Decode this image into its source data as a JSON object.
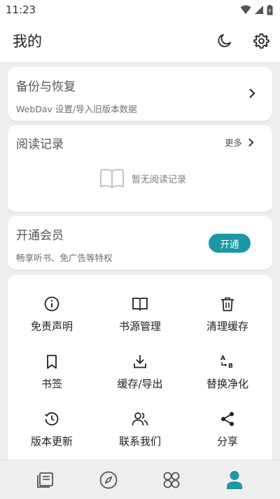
{
  "status_bar": {
    "time": "11:23",
    "icons": [
      "wifi-icon",
      "signal-icon",
      "battery-icon"
    ]
  },
  "app_bar": {
    "title": "我的",
    "actions": [
      "night-mode-icon",
      "settings-icon"
    ]
  },
  "backup_card": {
    "title": "备份与恢复",
    "subtitle": "WebDav 设置/导入旧版本数据"
  },
  "reading_card": {
    "title": "阅读记录",
    "more_label": "更多",
    "empty_text": "暂无阅读记录"
  },
  "vip_card": {
    "title": "开通会员",
    "subtitle": "畅享听书、免广告等特权",
    "button_label": "开通"
  },
  "tools": [
    {
      "label": "免责声明",
      "icon": "info-icon"
    },
    {
      "label": "书源管理",
      "icon": "open-book-icon"
    },
    {
      "label": "清理缓存",
      "icon": "trash-icon"
    },
    {
      "label": "书签",
      "icon": "bookmark-icon"
    },
    {
      "label": "缓存/导出",
      "icon": "download-icon"
    },
    {
      "label": "替换净化",
      "icon": "replace-icon"
    },
    {
      "label": "版本更新",
      "icon": "history-icon"
    },
    {
      "label": "联系我们",
      "icon": "group-icon"
    },
    {
      "label": "分享",
      "icon": "share-icon"
    }
  ],
  "bottom_nav": {
    "items": [
      "bookshelf-icon",
      "compass-icon",
      "apps-icon",
      "profile-icon"
    ],
    "active": "profile-icon",
    "active_color": "#1a98a3"
  },
  "colors": {
    "accent": "#1a98a3",
    "background": "#eeeeee",
    "card": "#ffffff"
  }
}
